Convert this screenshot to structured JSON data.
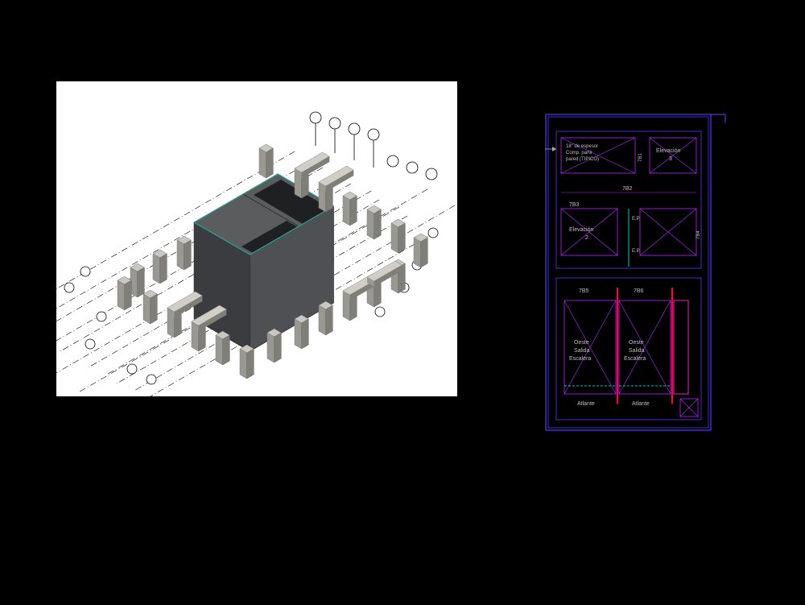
{
  "sheet": {
    "note_line1": "18\" de espesor",
    "note_line2": "Comp. partir",
    "note_line3": "pared (TIPICO)",
    "elev3_line1": "Elevación",
    "elev3_line2": "3",
    "elev2_line1": "Elevación",
    "elev2_line2": "2",
    "ep": "E.P.",
    "ref1": "7B1",
    "ref2": "7B2",
    "ref3": "7B3",
    "ref4": "7B4",
    "ref5": "7B5",
    "ref6": "7B6",
    "oeste_l1": "Oeste",
    "oeste_l2": "Salida",
    "oeste_l3": "Escalera",
    "atlante": "Atlante"
  }
}
